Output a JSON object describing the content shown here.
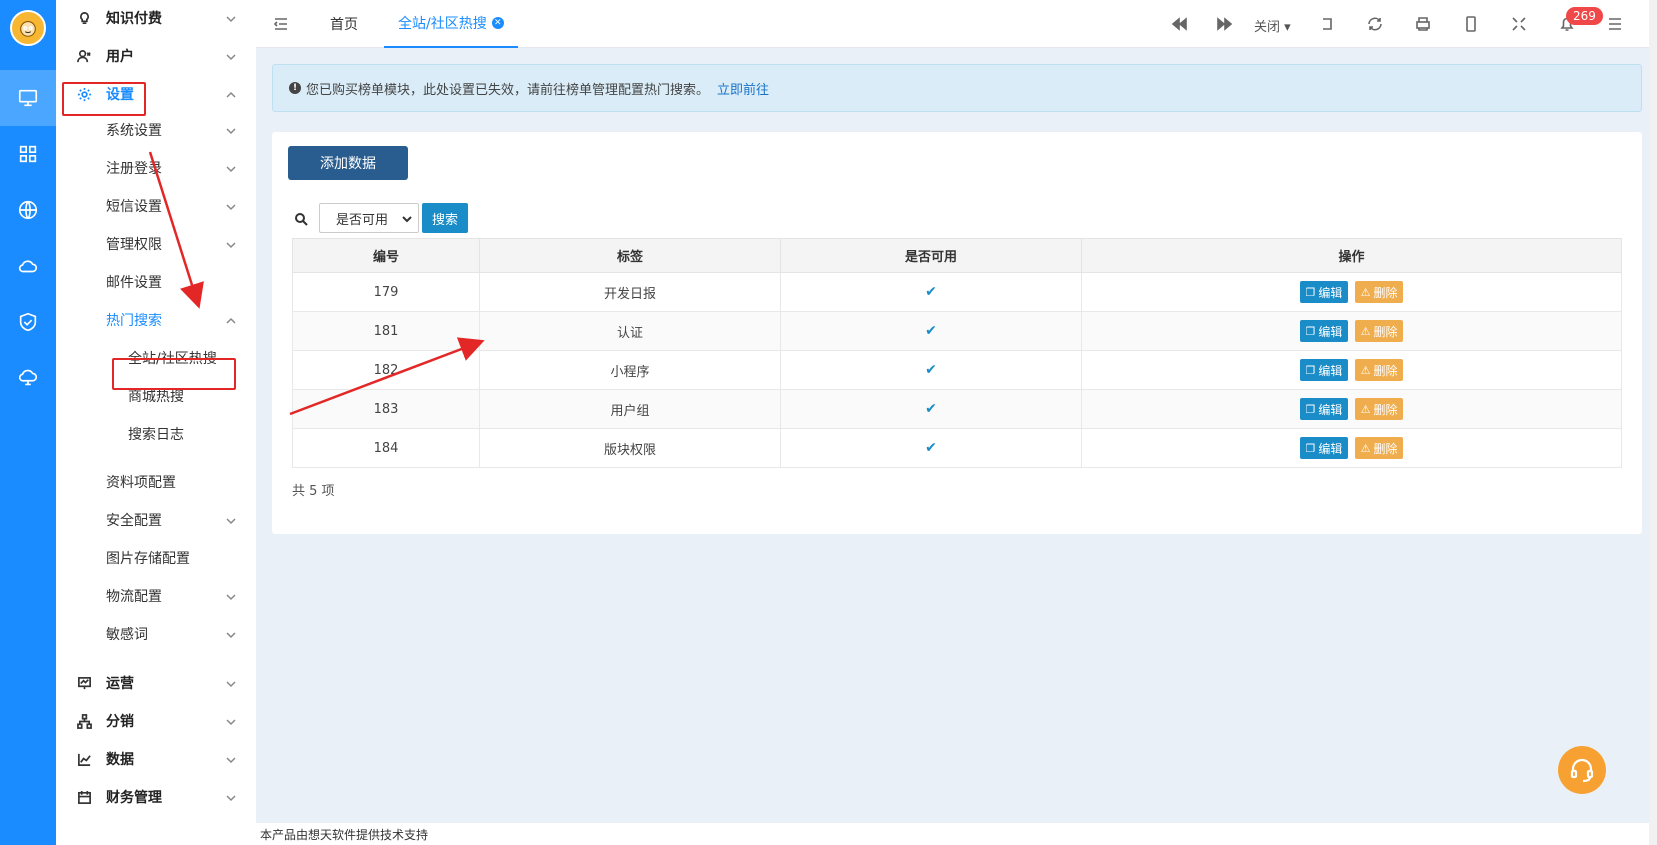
{
  "rail": {
    "icons": [
      "logo-icon",
      "monitor-icon",
      "grid-icon",
      "globe-icon",
      "cloud-icon",
      "shield-check-icon",
      "cloud-network-icon"
    ]
  },
  "sidebar": {
    "items": [
      {
        "label": "知识付费",
        "level": "top",
        "icon": "lightbulb-icon"
      },
      {
        "label": "用户",
        "level": "top",
        "icon": "users-icon"
      },
      {
        "label": "设置",
        "level": "top",
        "icon": "gear-icon",
        "expanded": true
      },
      {
        "label": "系统设置",
        "level": "sub"
      },
      {
        "label": "注册登录",
        "level": "sub"
      },
      {
        "label": "短信设置",
        "level": "sub"
      },
      {
        "label": "管理权限",
        "level": "sub"
      },
      {
        "label": "邮件设置",
        "level": "sub"
      },
      {
        "label": "热门搜索",
        "level": "sub",
        "expanded": true
      },
      {
        "label": "全站/社区热搜",
        "level": "sub2",
        "active": true
      },
      {
        "label": "商城热搜",
        "level": "sub2"
      },
      {
        "label": "搜索日志",
        "level": "sub2"
      },
      {
        "label": "资料项配置",
        "level": "sub"
      },
      {
        "label": "安全配置",
        "level": "sub"
      },
      {
        "label": "图片存储配置",
        "level": "sub"
      },
      {
        "label": "物流配置",
        "level": "sub"
      },
      {
        "label": "敏感词",
        "level": "sub"
      },
      {
        "label": "运营",
        "level": "top",
        "icon": "presentation-icon"
      },
      {
        "label": "分销",
        "level": "top",
        "icon": "hierarchy-icon"
      },
      {
        "label": "数据",
        "level": "top",
        "icon": "line-chart-icon"
      },
      {
        "label": "财务管理",
        "level": "top",
        "icon": "calendar-icon"
      }
    ]
  },
  "topbar": {
    "tabs": {
      "home": "首页",
      "current": "全站/社区热搜"
    },
    "close_label": "关闭",
    "notification_count": "269"
  },
  "notice": {
    "text": "您已购买榜单模块，此处设置已失效，请前往榜单管理配置热门搜索。",
    "link": "立即前往"
  },
  "toolbar": {
    "add_label": "添加数据",
    "filter_value": "是否可用",
    "search_label": "搜索"
  },
  "table": {
    "headers": [
      "编号",
      "标签",
      "是否可用",
      "操作"
    ],
    "rows": [
      {
        "id": "179",
        "tag": "开发日报",
        "enabled": "✔"
      },
      {
        "id": "181",
        "tag": "认证",
        "enabled": "✔"
      },
      {
        "id": "182",
        "tag": "小程序",
        "enabled": "✔"
      },
      {
        "id": "183",
        "tag": "用户组",
        "enabled": "✔"
      },
      {
        "id": "184",
        "tag": "版块权限",
        "enabled": "✔"
      }
    ],
    "edit_label": "编辑",
    "delete_label": "删除",
    "total": "共 5 项"
  },
  "footer": {
    "text": "本产品由想天软件提供技术支持"
  },
  "colors": {
    "primary": "#1a8cff",
    "annotation": "#e32727",
    "delete": "#f0ad4e"
  }
}
